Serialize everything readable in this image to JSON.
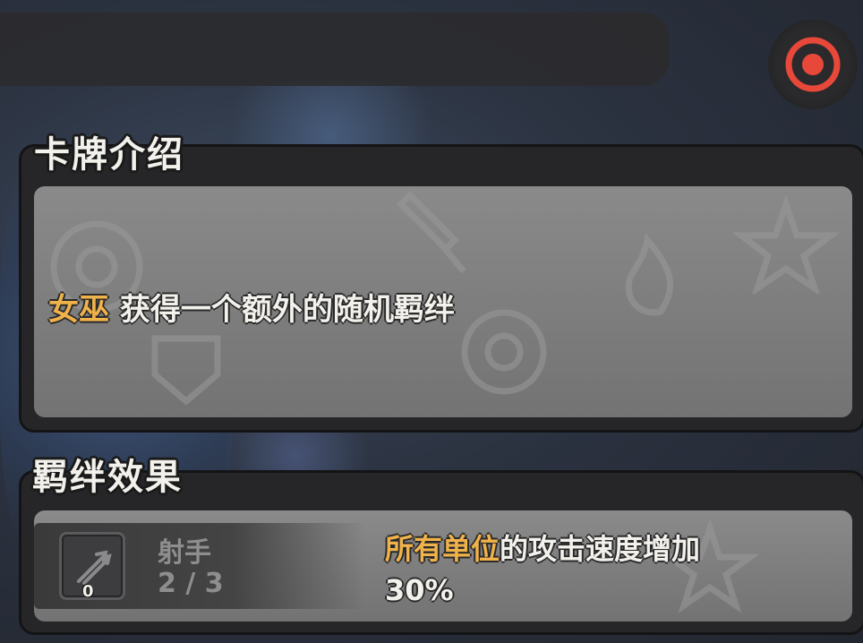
{
  "card_intro": {
    "title": "卡牌介绍",
    "highlight": "女巫",
    "description": " 获得一个额外的随机羁绊"
  },
  "bond_effect": {
    "title": "羁绊效果",
    "trait": {
      "icon": "arrows-icon",
      "count": "0",
      "name": "射手",
      "progress": "2 / 3"
    },
    "effect_highlight": "所有单位",
    "effect_text": "的攻击速度增加",
    "effect_value": "30%"
  },
  "colors": {
    "highlight": "#f0b24a",
    "target_ring": "#e8483a"
  },
  "icons": [
    "target-icon",
    "arrows-icon"
  ]
}
